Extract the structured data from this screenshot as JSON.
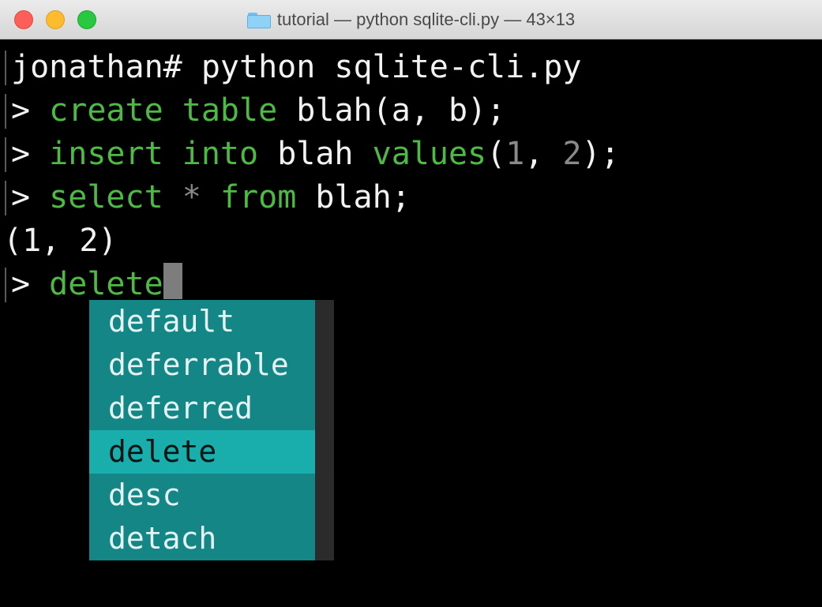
{
  "window": {
    "title": "tutorial — python sqlite-cli.py — 43×13",
    "folder_icon": "folder-icon",
    "controls": {
      "close_color": "#fc5f57",
      "minimize_color": "#fdbc2e",
      "zoom_color": "#28c840"
    }
  },
  "terminal": {
    "line1": {
      "text": "jonathan# python sqlite-cli.py"
    },
    "line2": {
      "prompt": "> ",
      "k1": "create",
      "k2": "table",
      "rest": "blah(a, b);"
    },
    "line3": {
      "prompt": "> ",
      "k1": "insert",
      "k2": "into",
      "t1": "blah",
      "k3": "values",
      "p1": "(",
      "n1": "1",
      "comma": ", ",
      "n2": "2",
      "p2": ");"
    },
    "line4": {
      "prompt": "> ",
      "k1": "select",
      "star": "*",
      "k2": "from",
      "rest": "blah;"
    },
    "output": "(1, 2)",
    "line6": {
      "prompt": "> ",
      "input": "delete"
    }
  },
  "completion": {
    "items": [
      "default",
      "deferrable",
      "deferred",
      "delete",
      "desc",
      "detach"
    ],
    "selected_index": 3,
    "colors": {
      "background": "#138685",
      "selected": "#19aeab"
    }
  }
}
